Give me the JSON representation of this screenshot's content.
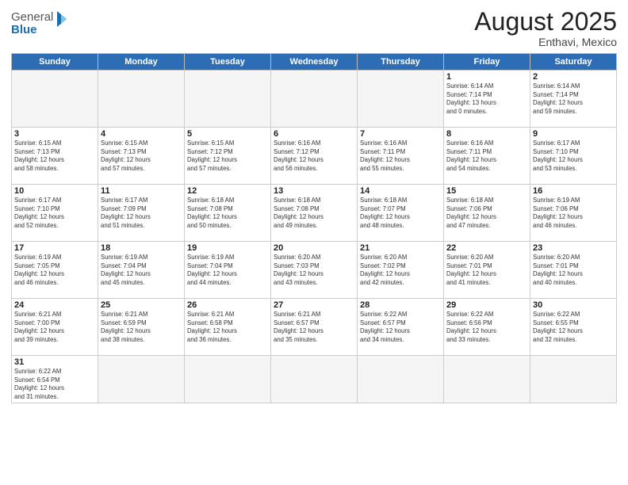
{
  "header": {
    "logo_general": "General",
    "logo_blue": "Blue",
    "title": "August 2025",
    "location": "Enthavi, Mexico"
  },
  "weekdays": [
    "Sunday",
    "Monday",
    "Tuesday",
    "Wednesday",
    "Thursday",
    "Friday",
    "Saturday"
  ],
  "weeks": [
    [
      {
        "day": "",
        "info": ""
      },
      {
        "day": "",
        "info": ""
      },
      {
        "day": "",
        "info": ""
      },
      {
        "day": "",
        "info": ""
      },
      {
        "day": "",
        "info": ""
      },
      {
        "day": "1",
        "info": "Sunrise: 6:14 AM\nSunset: 7:14 PM\nDaylight: 13 hours\nand 0 minutes."
      },
      {
        "day": "2",
        "info": "Sunrise: 6:14 AM\nSunset: 7:14 PM\nDaylight: 12 hours\nand 59 minutes."
      }
    ],
    [
      {
        "day": "3",
        "info": "Sunrise: 6:15 AM\nSunset: 7:13 PM\nDaylight: 12 hours\nand 58 minutes."
      },
      {
        "day": "4",
        "info": "Sunrise: 6:15 AM\nSunset: 7:13 PM\nDaylight: 12 hours\nand 57 minutes."
      },
      {
        "day": "5",
        "info": "Sunrise: 6:15 AM\nSunset: 7:12 PM\nDaylight: 12 hours\nand 57 minutes."
      },
      {
        "day": "6",
        "info": "Sunrise: 6:16 AM\nSunset: 7:12 PM\nDaylight: 12 hours\nand 56 minutes."
      },
      {
        "day": "7",
        "info": "Sunrise: 6:16 AM\nSunset: 7:11 PM\nDaylight: 12 hours\nand 55 minutes."
      },
      {
        "day": "8",
        "info": "Sunrise: 6:16 AM\nSunset: 7:11 PM\nDaylight: 12 hours\nand 54 minutes."
      },
      {
        "day": "9",
        "info": "Sunrise: 6:17 AM\nSunset: 7:10 PM\nDaylight: 12 hours\nand 53 minutes."
      }
    ],
    [
      {
        "day": "10",
        "info": "Sunrise: 6:17 AM\nSunset: 7:10 PM\nDaylight: 12 hours\nand 52 minutes."
      },
      {
        "day": "11",
        "info": "Sunrise: 6:17 AM\nSunset: 7:09 PM\nDaylight: 12 hours\nand 51 minutes."
      },
      {
        "day": "12",
        "info": "Sunrise: 6:18 AM\nSunset: 7:08 PM\nDaylight: 12 hours\nand 50 minutes."
      },
      {
        "day": "13",
        "info": "Sunrise: 6:18 AM\nSunset: 7:08 PM\nDaylight: 12 hours\nand 49 minutes."
      },
      {
        "day": "14",
        "info": "Sunrise: 6:18 AM\nSunset: 7:07 PM\nDaylight: 12 hours\nand 48 minutes."
      },
      {
        "day": "15",
        "info": "Sunrise: 6:18 AM\nSunset: 7:06 PM\nDaylight: 12 hours\nand 47 minutes."
      },
      {
        "day": "16",
        "info": "Sunrise: 6:19 AM\nSunset: 7:06 PM\nDaylight: 12 hours\nand 46 minutes."
      }
    ],
    [
      {
        "day": "17",
        "info": "Sunrise: 6:19 AM\nSunset: 7:05 PM\nDaylight: 12 hours\nand 46 minutes."
      },
      {
        "day": "18",
        "info": "Sunrise: 6:19 AM\nSunset: 7:04 PM\nDaylight: 12 hours\nand 45 minutes."
      },
      {
        "day": "19",
        "info": "Sunrise: 6:19 AM\nSunset: 7:04 PM\nDaylight: 12 hours\nand 44 minutes."
      },
      {
        "day": "20",
        "info": "Sunrise: 6:20 AM\nSunset: 7:03 PM\nDaylight: 12 hours\nand 43 minutes."
      },
      {
        "day": "21",
        "info": "Sunrise: 6:20 AM\nSunset: 7:02 PM\nDaylight: 12 hours\nand 42 minutes."
      },
      {
        "day": "22",
        "info": "Sunrise: 6:20 AM\nSunset: 7:01 PM\nDaylight: 12 hours\nand 41 minutes."
      },
      {
        "day": "23",
        "info": "Sunrise: 6:20 AM\nSunset: 7:01 PM\nDaylight: 12 hours\nand 40 minutes."
      }
    ],
    [
      {
        "day": "24",
        "info": "Sunrise: 6:21 AM\nSunset: 7:00 PM\nDaylight: 12 hours\nand 39 minutes."
      },
      {
        "day": "25",
        "info": "Sunrise: 6:21 AM\nSunset: 6:59 PM\nDaylight: 12 hours\nand 38 minutes."
      },
      {
        "day": "26",
        "info": "Sunrise: 6:21 AM\nSunset: 6:58 PM\nDaylight: 12 hours\nand 36 minutes."
      },
      {
        "day": "27",
        "info": "Sunrise: 6:21 AM\nSunset: 6:57 PM\nDaylight: 12 hours\nand 35 minutes."
      },
      {
        "day": "28",
        "info": "Sunrise: 6:22 AM\nSunset: 6:57 PM\nDaylight: 12 hours\nand 34 minutes."
      },
      {
        "day": "29",
        "info": "Sunrise: 6:22 AM\nSunset: 6:56 PM\nDaylight: 12 hours\nand 33 minutes."
      },
      {
        "day": "30",
        "info": "Sunrise: 6:22 AM\nSunset: 6:55 PM\nDaylight: 12 hours\nand 32 minutes."
      }
    ],
    [
      {
        "day": "31",
        "info": "Sunrise: 6:22 AM\nSunset: 6:54 PM\nDaylight: 12 hours\nand 31 minutes."
      },
      {
        "day": "",
        "info": ""
      },
      {
        "day": "",
        "info": ""
      },
      {
        "day": "",
        "info": ""
      },
      {
        "day": "",
        "info": ""
      },
      {
        "day": "",
        "info": ""
      },
      {
        "day": "",
        "info": ""
      }
    ]
  ]
}
